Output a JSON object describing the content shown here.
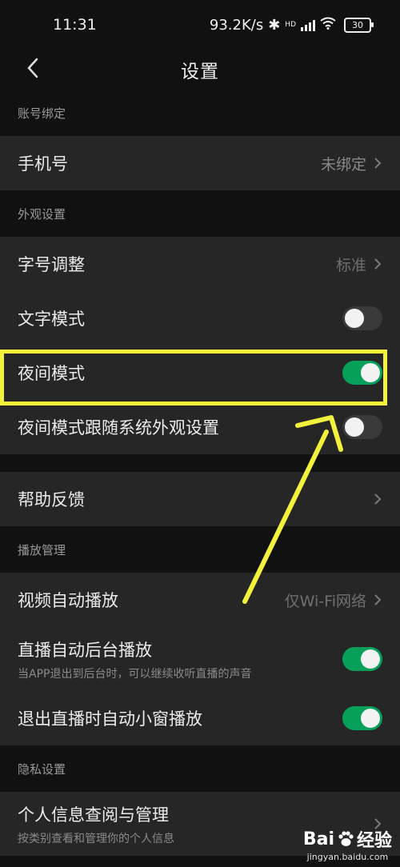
{
  "status": {
    "time": "11:31",
    "speed": "93.2K/s",
    "network": "HD",
    "battery": "30"
  },
  "nav": {
    "title": "设置"
  },
  "sections": {
    "account": {
      "header": "账号绑定",
      "phone": {
        "label": "手机号",
        "value": "未绑定"
      }
    },
    "appearance": {
      "header": "外观设置",
      "font_size": {
        "label": "字号调整",
        "value": "标准"
      },
      "text_mode": {
        "label": "文字模式",
        "toggle": false
      },
      "night_mode": {
        "label": "夜间模式",
        "toggle": true
      },
      "night_follow": {
        "label": "夜间模式跟随系统外观设置",
        "toggle": false
      }
    },
    "help": {
      "label": "帮助反馈"
    },
    "playback": {
      "header": "播放管理",
      "autoplay": {
        "label": "视频自动播放",
        "value": "仅Wi-Fi网络"
      },
      "live_bg": {
        "label": "直播自动后台播放",
        "sub": "当APP退出到后台时，可以继续收听直播的声音",
        "toggle": true
      },
      "live_pip": {
        "label": "退出直播时自动小窗播放",
        "toggle": true
      }
    },
    "privacy": {
      "header": "隐私设置",
      "personal": {
        "label": "个人信息查阅与管理",
        "sub": "按类别查看和管理你的个人信息"
      }
    }
  },
  "watermark": {
    "brand_left": "Bai",
    "brand_right": "经验",
    "url": "jingyan.baidu.com"
  },
  "colors": {
    "toggle_on": "#07a05a",
    "highlight": "#f2f23c",
    "background": "#111111",
    "card": "#262626"
  }
}
